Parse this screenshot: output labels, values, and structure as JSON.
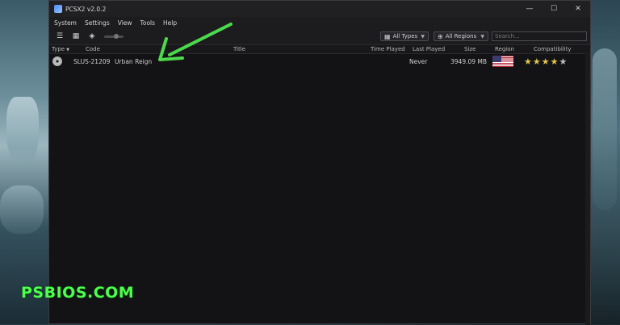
{
  "window": {
    "title": "PCSX2 v2.0.2",
    "controls": {
      "minimize": "—",
      "maximize": "☐",
      "close": "✕"
    }
  },
  "menu": {
    "items": [
      "System",
      "Settings",
      "View",
      "Tools",
      "Help"
    ]
  },
  "toolbar": {
    "filter_types": "All Types",
    "filter_regions": "All Regions",
    "search_placeholder": "Search..."
  },
  "table": {
    "headers": {
      "type": "Type",
      "code": "Code",
      "title": "Title",
      "time_played": "Time Played",
      "last_played": "Last Played",
      "size": "Size",
      "region": "Region",
      "compatibility": "Compatibility"
    },
    "rows": [
      {
        "code": "SLUS-21209",
        "title": "Urban Reign",
        "time_played": "",
        "last_played": "Never",
        "size": "3949.09 MB",
        "region": "us-flag-icon",
        "compatibility_stars": 5,
        "compatibility_full_stars": 4
      }
    ]
  },
  "watermark": "PSBIOS.COM",
  "colors": {
    "annotation_arrow": "#4cd94c",
    "watermark": "#4cff4c",
    "star": "#e0c54a"
  }
}
